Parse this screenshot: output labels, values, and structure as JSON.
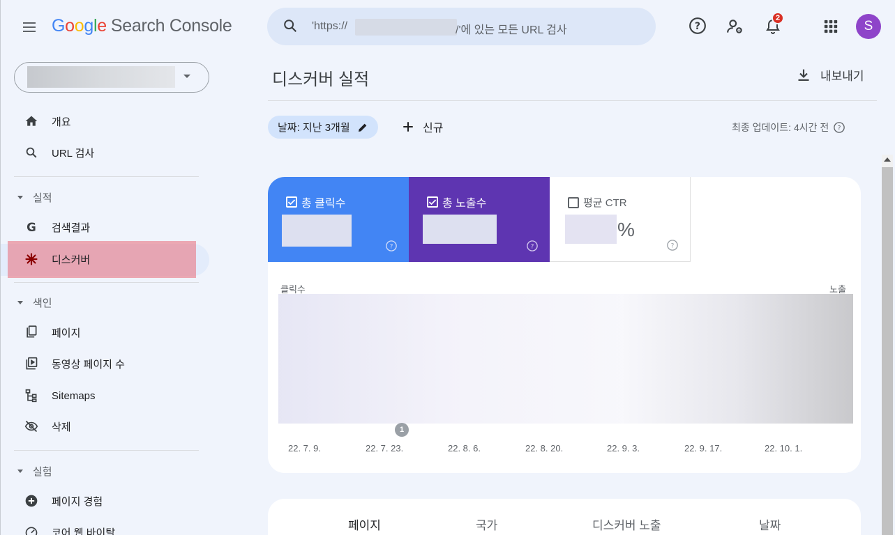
{
  "header": {
    "logo": {
      "g": "G",
      "o1": "o",
      "o2": "o",
      "g2": "g",
      "l": "l",
      "e": "e",
      "product": "Search Console"
    },
    "search": {
      "prefix": "'https://",
      "suffix": "/'에 있는 모든 URL 검사"
    },
    "notification_count": "2",
    "avatar_letter": "S"
  },
  "sidebar": {
    "overview": "개요",
    "url_inspection": "URL 검사",
    "section_performance": "실적",
    "search_results": "검색결과",
    "discover": "디스커버",
    "section_index": "색인",
    "pages": "페이지",
    "video_pages": "동영상 페이지 수",
    "sitemaps": "Sitemaps",
    "removals": "삭제",
    "section_experience": "실험",
    "page_experience": "페이지 경험",
    "core_web_vitals": "코어 웹 바이탈"
  },
  "main": {
    "title": "디스커버 실적",
    "export": "내보내기",
    "date_chip": "날짜: 지난 3개월",
    "new": "신규",
    "updated": "최종 업데이트: 4시간 전"
  },
  "metrics": {
    "clicks": "총 클릭수",
    "impressions": "총 노출수",
    "ctr": "평균 CTR",
    "ctr_unit": "%"
  },
  "chart_data": {
    "type": "line",
    "ylabel_left": "클릭수",
    "ylabel_right": "노출",
    "x_ticks": [
      "22. 7. 9.",
      "22. 7. 23.",
      "22. 8. 6.",
      "22. 8. 20.",
      "22. 9. 3.",
      "22. 9. 17.",
      "22. 10. 1."
    ],
    "annotation": "1"
  },
  "tabs": [
    "페이지",
    "국가",
    "디스커버 노출",
    "날짜"
  ],
  "colors": {
    "clicks": "#4285f4",
    "impressions": "#5e35b1",
    "highlight": "#e8808c"
  }
}
